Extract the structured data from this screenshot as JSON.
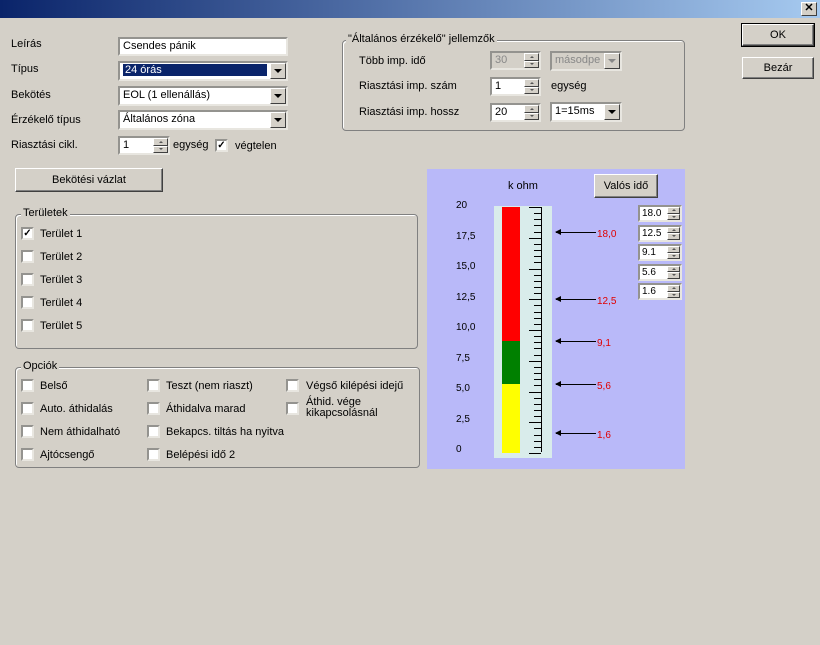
{
  "window": {
    "close_glyph": "✕"
  },
  "form": {
    "leiras_label": "Leírás",
    "leiras_value": "Csendes pánik",
    "tipus_label": "Típus",
    "tipus_value": "24 órás",
    "bekotes_label": "Bekötés",
    "bekotes_value": "EOL (1 ellenállás)",
    "erzekelo_label": "Érzékelő típus",
    "erzekelo_value": "Általános zóna",
    "riasztasi_cikl_label": "Riasztási cikl.",
    "riasztasi_cikl_value": "1",
    "egyseg_label": "egység",
    "vegtelen_label": "végtelen",
    "vegtelen_checked": true
  },
  "buttons": {
    "ok": "OK",
    "bezar": "Bezár",
    "bekotesi_vazlat": "Bekötési vázlat",
    "valos_ido": "Valós idő"
  },
  "detector_group": {
    "title": "\"Általános érzékelő\" jellemzők",
    "tobb_imp_ido_label": "Több imp. idő",
    "tobb_imp_ido_value": "30",
    "tobb_imp_ido_unit": "másodpe",
    "imp_szam_label": "Riasztási imp. szám",
    "imp_szam_value": "1",
    "imp_szam_unit": "egység",
    "imp_hossz_label": "Riasztási imp. hossz",
    "imp_hossz_value": "20",
    "imp_hossz_unit": "1=15ms"
  },
  "teruletek": {
    "title": "Területek",
    "items": [
      {
        "label": "Terület 1",
        "checked": true
      },
      {
        "label": "Terület 2",
        "checked": false
      },
      {
        "label": "Terület 3",
        "checked": false
      },
      {
        "label": "Terület 4",
        "checked": false
      },
      {
        "label": "Terület 5",
        "checked": false
      }
    ]
  },
  "opciok": {
    "title": "Opciók",
    "col1": [
      {
        "label": "Belső",
        "checked": false
      },
      {
        "label": "Auto. áthidalás",
        "checked": false
      },
      {
        "label": "Nem áthidalható",
        "checked": false
      },
      {
        "label": "Ajtócsengő",
        "checked": false
      }
    ],
    "col2": [
      {
        "label": "Teszt (nem riaszt)",
        "checked": false
      },
      {
        "label": "Áthidalva marad",
        "checked": false
      },
      {
        "label": "Bekapcs. tiltás ha nyitva",
        "checked": false
      },
      {
        "label": "Belépési idő 2",
        "checked": false
      }
    ],
    "col3": [
      {
        "label": "Végső kilépési idejű",
        "checked": false
      },
      {
        "label": "Áthid. vége kikapcsolásnál",
        "checked": false
      }
    ]
  },
  "gauge": {
    "unit_label": "k ohm",
    "range": [
      0,
      20
    ],
    "scale_labels": [
      "20",
      "17,5",
      "15,0",
      "12,5",
      "10,0",
      "7,5",
      "5,0",
      "2,5",
      "0"
    ],
    "colors": {
      "red": "#ff0000",
      "green": "#008000",
      "yellow": "#ffff00",
      "panel": "#b9b9f9"
    },
    "zones": [
      {
        "color": "yellow",
        "from": 0,
        "to": 5.6
      },
      {
        "color": "green",
        "from": 5.6,
        "to": 9.1
      },
      {
        "color": "red",
        "from": 9.1,
        "to": 20
      }
    ],
    "markers": [
      {
        "label": "18,0",
        "value": 18.0
      },
      {
        "label": "12,5",
        "value": 12.5
      },
      {
        "label": "9,1",
        "value": 9.1
      },
      {
        "label": "5,6",
        "value": 5.6
      },
      {
        "label": "1,6",
        "value": 1.6
      }
    ],
    "threshold_inputs": [
      "18.0",
      "12.5",
      "9.1",
      "5.6",
      "1.6"
    ]
  }
}
